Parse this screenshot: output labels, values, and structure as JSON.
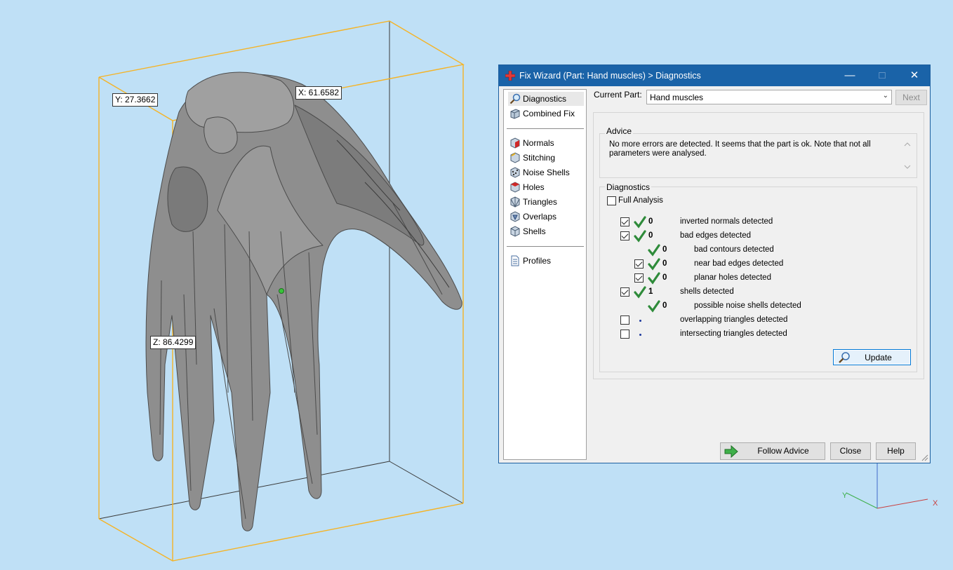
{
  "viewport": {
    "dim_y": "Y: 27.3662",
    "dim_x": "X: 61.6582",
    "dim_z": "Z: 86.4299",
    "axis_x_label": "X",
    "axis_y_label": "Y"
  },
  "dialog": {
    "title": "Fix Wizard (Part: Hand muscles) > Diagnostics",
    "nav": {
      "diagnostics": "Diagnostics",
      "combined_fix": "Combined Fix",
      "normals": "Normals",
      "stitching": "Stitching",
      "noise_shells": "Noise Shells",
      "holes": "Holes",
      "triangles": "Triangles",
      "overlaps": "Overlaps",
      "shells": "Shells",
      "profiles": "Profiles"
    },
    "current_part_label": "Current Part:",
    "current_part_value": "Hand muscles",
    "next_label": "Next",
    "advice_title": "Advice",
    "advice_text": "No more errors are detected. It seems that the part is ok. Note that not all parameters were analysed.",
    "diagnostics_title": "Diagnostics",
    "full_analysis_label": "Full Analysis",
    "rows": [
      {
        "count": "0",
        "label": "inverted normals detected",
        "checked": true,
        "status": "ok"
      },
      {
        "count": "0",
        "label": "bad edges detected",
        "checked": true,
        "status": "ok"
      },
      {
        "count": "0",
        "label": "bad contours detected",
        "checked": null,
        "status": "ok"
      },
      {
        "count": "0",
        "label": "near bad edges detected",
        "checked": true,
        "status": "ok"
      },
      {
        "count": "0",
        "label": "planar holes detected",
        "checked": true,
        "status": "ok"
      },
      {
        "count": "1",
        "label": "shells detected",
        "checked": true,
        "status": "ok"
      },
      {
        "count": "0",
        "label": "possible noise shells detected",
        "checked": null,
        "status": "ok"
      },
      {
        "count": "",
        "label": "overlapping triangles detected",
        "checked": false,
        "status": "not-analysed"
      },
      {
        "count": "",
        "label": "intersecting triangles detected",
        "checked": false,
        "status": "not-analysed"
      }
    ],
    "update_label": "Update",
    "follow_advice_label": "Follow Advice",
    "close_label": "Close",
    "help_label": "Help"
  },
  "colors": {
    "titlebar": "#1a63a8",
    "bbox": "#f5b325",
    "check_green": "#2e8b3a",
    "viewport_bg": "#bfe0f6"
  }
}
